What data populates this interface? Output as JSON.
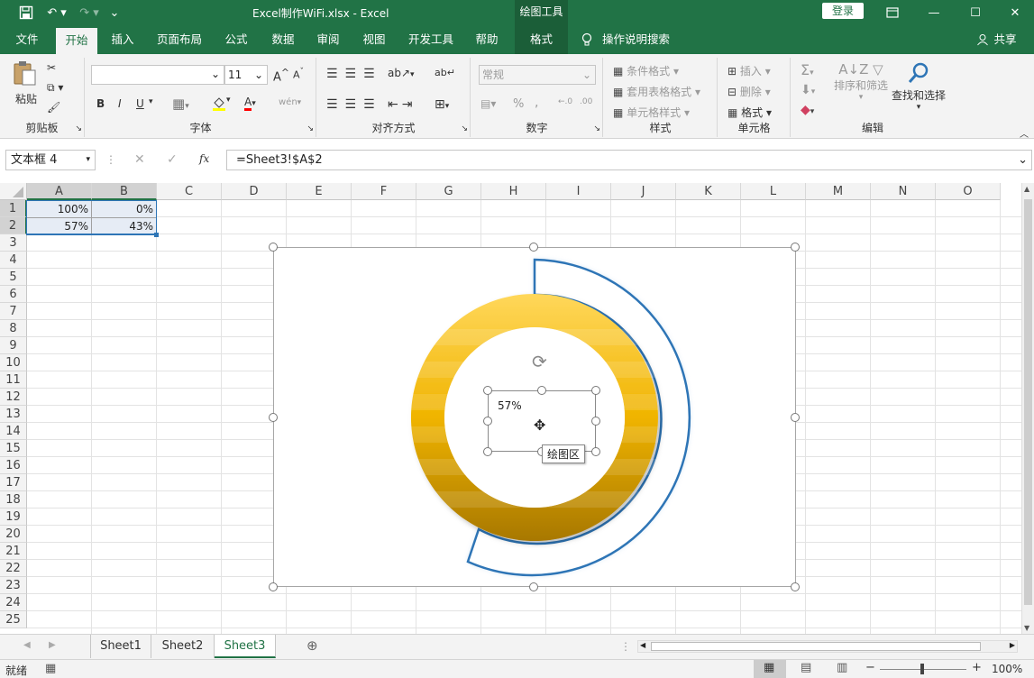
{
  "titlebar": {
    "doc_title": "Excel制作WiFi.xlsx  -  Excel",
    "context_label": "绘图工具",
    "login_label": "登录"
  },
  "tabs": [
    "文件",
    "开始",
    "插入",
    "页面布局",
    "公式",
    "数据",
    "审阅",
    "视图",
    "开发工具",
    "帮助",
    "格式"
  ],
  "tell_me": "操作说明搜索",
  "share": "共享",
  "ribbon": {
    "clipboard": {
      "paste": "粘贴",
      "label": "剪贴板"
    },
    "font": {
      "size": "11",
      "label": "字体",
      "bold": "B",
      "italic": "I",
      "underline": "U"
    },
    "alignment": {
      "label": "对齐方式"
    },
    "number": {
      "format": "常规",
      "percent": "%",
      "comma": ",",
      "label": "数字"
    },
    "styles": {
      "conditional": "条件格式",
      "table": "套用表格格式",
      "cell": "单元格样式",
      "label": "样式"
    },
    "cells": {
      "insert": "插入",
      "delete": "删除",
      "format": "格式",
      "label": "单元格"
    },
    "editing": {
      "sort": "排序和筛选",
      "find": "查找和选择",
      "label": "编辑"
    }
  },
  "formula_bar": {
    "name_box": "文本框 4",
    "formula": "=Sheet3!$A$2"
  },
  "columns": [
    "A",
    "B",
    "C",
    "D",
    "E",
    "F",
    "G",
    "H",
    "I",
    "J",
    "K",
    "L",
    "M",
    "N",
    "O"
  ],
  "rows": [
    "1",
    "2",
    "3",
    "4",
    "5",
    "6",
    "7",
    "8",
    "9",
    "10",
    "11",
    "12",
    "13",
    "14",
    "15",
    "16",
    "17",
    "18",
    "19",
    "20",
    "21",
    "22",
    "23",
    "24",
    "25"
  ],
  "cells": {
    "A1": "100%",
    "B1": "0%",
    "A2": "57%",
    "B2": "43%"
  },
  "chart": {
    "textbox_value": "57%",
    "tooltip": "绘图区",
    "ring_colors": {
      "light": "#ffd75a",
      "dark": "#a87800",
      "arc_stroke": "#2e75b6",
      "arc_glow": "#9dc3e6"
    }
  },
  "sheets": [
    "Sheet1",
    "Sheet2",
    "Sheet3"
  ],
  "active_sheet": "Sheet3",
  "status": {
    "ready": "就绪",
    "zoom": "100%"
  }
}
